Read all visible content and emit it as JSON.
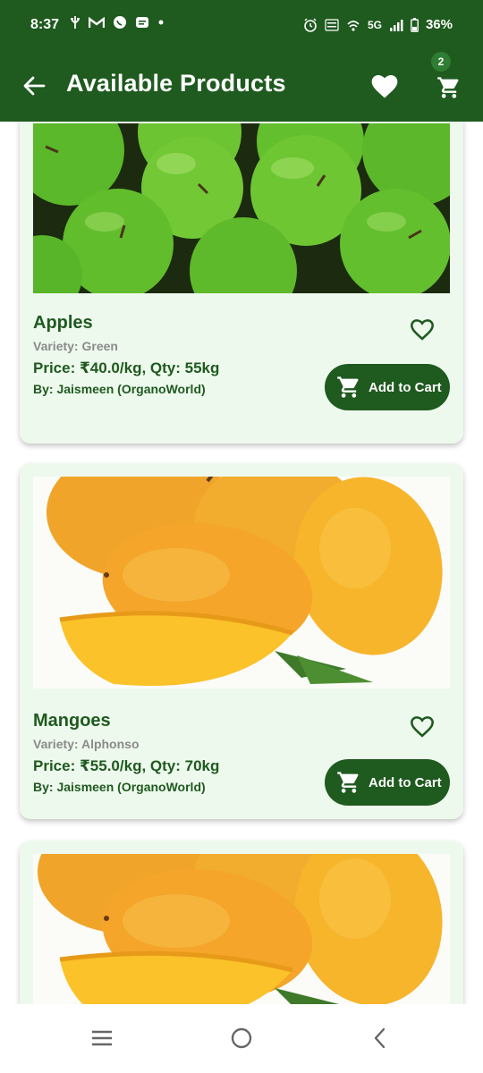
{
  "status_bar": {
    "time": "8:37",
    "network": "5G",
    "battery": "36%"
  },
  "app_bar": {
    "title": "Available Products",
    "cart_count": "2",
    "back_icon": "arrow-left-icon",
    "favorites_icon": "heart-filled-icon",
    "cart_icon": "cart-icon"
  },
  "colors": {
    "primary": "#1f5a1f",
    "card_bg": "#eef9ee",
    "badge": "#2e7d32",
    "muted_text": "#8a8a8a"
  },
  "products": [
    {
      "name": "Apples",
      "variety": "Variety: Green",
      "price_qty": "Price: ₹40.0/kg, Qty: 55kg",
      "seller": "By: Jaismeen (OrganoWorld)",
      "button_label": "Add to Cart",
      "image": "green-apples-photo"
    },
    {
      "name": "Mangoes",
      "variety": "Variety: Alphonso",
      "price_qty": "Price: ₹55.0/kg, Qty: 70kg",
      "seller": "By: Jaismeen (OrganoWorld)",
      "button_label": "Add to Cart",
      "image": "mangoes-photo"
    },
    {
      "image": "mangoes-photo"
    }
  ],
  "nav_bar": {
    "icons": [
      "recents-icon",
      "home-icon",
      "back-icon"
    ]
  }
}
